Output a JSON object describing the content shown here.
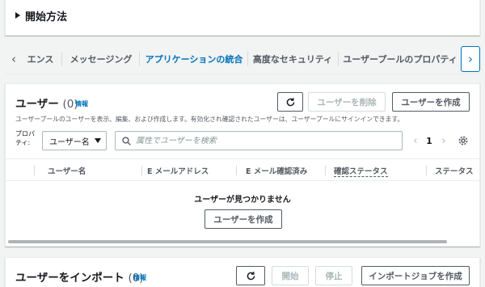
{
  "getting_started": {
    "title": "開始方法"
  },
  "tabs": [
    {
      "label": "エンス",
      "active": false
    },
    {
      "label": "メッセージング",
      "active": false
    },
    {
      "label": "アプリケーションの統合",
      "active": true
    },
    {
      "label": "高度なセキュリティ",
      "active": false
    },
    {
      "label": "ユーザープールのプロパティ",
      "active": false
    }
  ],
  "users": {
    "title": "ユーザー",
    "count": "(0)",
    "info": "情報",
    "refresh_icon": "refresh-icon",
    "delete_label": "ユーザーを削除",
    "create_label": "ユーザーを作成",
    "description": "ユーザープールのユーザーを表示、編集、および作成します。有効化され確認されたユーザーは、ユーザープールにサインインできます。",
    "property_label": "プロパティ:",
    "property_value": "ユーザー名",
    "search_placeholder": "属性でユーザーを検索",
    "page": "1",
    "columns": [
      "ユーザー名",
      "E メールアドレス",
      "E メール確認済み",
      "確認ステータス",
      "ステータス"
    ],
    "empty_message": "ユーザーが見つかりません",
    "empty_create_label": "ユーザーを作成"
  },
  "import": {
    "title": "ユーザーをインポート",
    "count": "(0)",
    "info": "情報",
    "start_label": "開始",
    "stop_label": "停止",
    "create_job_label": "インポートジョブを作成"
  },
  "colors": {
    "accent": "#0073bb",
    "text": "#16191f",
    "muted": "#545b64",
    "background": "#f2f3f3"
  }
}
